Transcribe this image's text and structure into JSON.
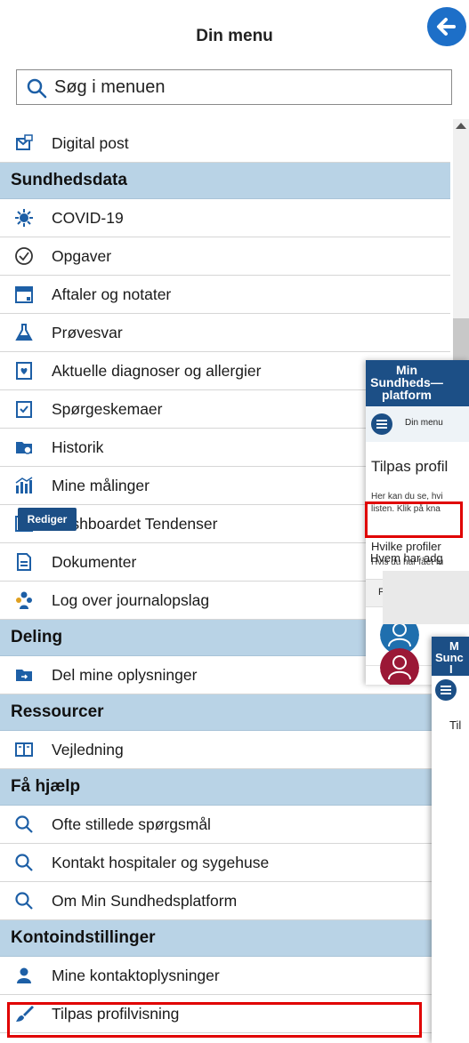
{
  "menu": {
    "title": "Din menu",
    "search_placeholder": "Søg i menuen"
  },
  "items": [
    {
      "type": "item",
      "label": "Digital post",
      "icon": "digital-post-icon"
    },
    {
      "type": "section",
      "label": "Sundhedsdata"
    },
    {
      "type": "item",
      "label": "COVID-19",
      "icon": "covid-virus-icon"
    },
    {
      "type": "item",
      "label": "Opgaver",
      "icon": "check-circle-icon"
    },
    {
      "type": "item",
      "label": "Aftaler og notater",
      "icon": "calendar-icon"
    },
    {
      "type": "item",
      "label": "Prøvesvar",
      "icon": "flask-icon"
    },
    {
      "type": "item",
      "label": "Aktuelle diagnoser og allergier",
      "icon": "diagnosis-icon"
    },
    {
      "type": "item",
      "label": "Spørgeskemaer",
      "icon": "questionnaire-icon"
    },
    {
      "type": "item",
      "label": "Historik",
      "icon": "history-folder-icon"
    },
    {
      "type": "item",
      "label": "Mine målinger",
      "icon": "measurements-icon"
    },
    {
      "type": "item",
      "label": "Dashboardet Tendenser",
      "icon": "trend-chart-icon"
    },
    {
      "type": "item",
      "label": "Dokumenter",
      "icon": "document-icon"
    },
    {
      "type": "item",
      "label": "Log over journalopslag",
      "icon": "log-people-icon"
    },
    {
      "type": "section",
      "label": "Deling"
    },
    {
      "type": "item",
      "label": "Del mine oplysninger",
      "icon": "share-folder-icon"
    },
    {
      "type": "section",
      "label": "Ressourcer"
    },
    {
      "type": "item",
      "label": "Vejledning",
      "icon": "book-icon"
    },
    {
      "type": "section",
      "label": "Få hjælp"
    },
    {
      "type": "item",
      "label": "Ofte stillede spørgsmål",
      "icon": "search-icon"
    },
    {
      "type": "item",
      "label": "Kontakt hospitaler og sygehuse",
      "icon": "search-icon"
    },
    {
      "type": "item",
      "label": "Om Min Sundhedsplatform",
      "icon": "search-icon"
    },
    {
      "type": "section",
      "label": "Kontoindstillinger"
    },
    {
      "type": "item",
      "label": "Mine kontaktoplysninger",
      "icon": "person-icon"
    },
    {
      "type": "item",
      "label": "Tilpas profilvisning",
      "icon": "brush-icon"
    }
  ],
  "preview": {
    "logo_line1": "Min",
    "logo_line2": "Sundheds—",
    "logo_line3": "platform",
    "menu_label": "Din menu",
    "heading": "Tilpas profil",
    "text_line1": "Her kan du se, hvi",
    "text_line2": "listen. Klik på kna",
    "subheading": "Hvilke profiler",
    "subtext": "Hvis du har fået fu",
    "col_photo": "Foto",
    "edit_button": "Rediger",
    "who_access": "Hvem har adg"
  },
  "preview2": {
    "logo_line1": "M",
    "logo_line2": "Sunc",
    "logo_line3": "I",
    "text": "Til"
  },
  "colors": {
    "section_bg": "#b9d3e6",
    "brand_blue": "#1c4f86",
    "highlight_red": "#e00000"
  }
}
